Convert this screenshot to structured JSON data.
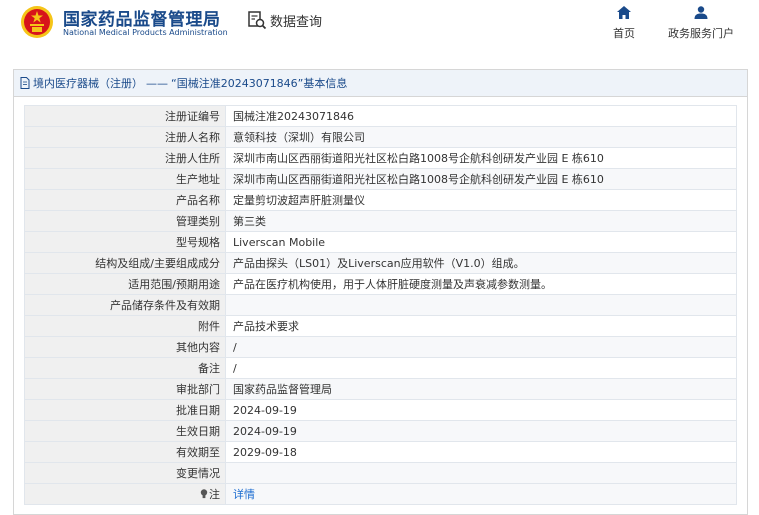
{
  "header": {
    "site_name_cn": "国家药品监督管理局",
    "site_name_en": "National Medical Products Administration",
    "query_label": "数据查询",
    "nav": {
      "home": "首页",
      "portal": "政务服务门户"
    }
  },
  "breadcrumb": {
    "category": "境内医疗器械（注册）",
    "separator": "——",
    "title": "“国械注准20243071846”基本信息"
  },
  "rows": [
    {
      "label": "注册证编号",
      "value": "国械注准20243071846"
    },
    {
      "label": "注册人名称",
      "value": "意领科技（深圳）有限公司"
    },
    {
      "label": "注册人住所",
      "value": "深圳市南山区西丽街道阳光社区松白路1008号企航科创研发产业园 E 栋610"
    },
    {
      "label": "生产地址",
      "value": "深圳市南山区西丽街道阳光社区松白路1008号企航科创研发产业园 E 栋610"
    },
    {
      "label": "产品名称",
      "value": "定量剪切波超声肝脏测量仪"
    },
    {
      "label": "管理类别",
      "value": "第三类"
    },
    {
      "label": "型号规格",
      "value": "Liverscan Mobile"
    },
    {
      "label": "结构及组成/主要组成成分",
      "value": "产品由探头（LS01）及Liverscan应用软件（V1.0）组成。"
    },
    {
      "label": "适用范围/预期用途",
      "value": "产品在医疗机构使用，用于人体肝脏硬度测量及声衰减参数测量。"
    },
    {
      "label": "产品储存条件及有效期",
      "value": ""
    },
    {
      "label": "附件",
      "value": "产品技术要求"
    },
    {
      "label": "其他内容",
      "value": "/"
    },
    {
      "label": "备注",
      "value": "/"
    },
    {
      "label": "审批部门",
      "value": "国家药品监督管理局"
    },
    {
      "label": "批准日期",
      "value": "2024-09-19"
    },
    {
      "label": "生效日期",
      "value": "2024-09-19"
    },
    {
      "label": "有效期至",
      "value": "2029-09-18"
    },
    {
      "label": "变更情况",
      "value": ""
    }
  ],
  "note": {
    "label": "注",
    "link": "详情"
  },
  "colors": {
    "brand": "#1a4a8a",
    "link": "#1a6bd0",
    "emblem_red": "#d7141a",
    "emblem_gold": "#f5c518"
  }
}
